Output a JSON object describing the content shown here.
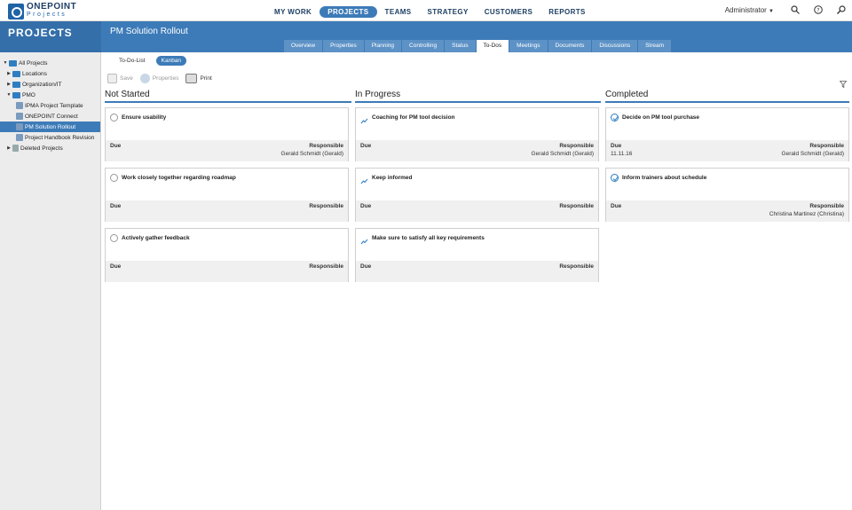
{
  "brand": {
    "line1": "ONEPOINT",
    "line2": "Projects"
  },
  "nav": [
    {
      "label": "MY WORK"
    },
    {
      "label": "PROJECTS"
    },
    {
      "label": "TEAMS"
    },
    {
      "label": "STRATEGY"
    },
    {
      "label": "CUSTOMERS"
    },
    {
      "label": "REPORTS"
    }
  ],
  "user": {
    "label": "Administrator"
  },
  "header": {
    "section": "PROJECTS",
    "project": "PM Solution Rollout"
  },
  "tabs": [
    {
      "label": "Overview"
    },
    {
      "label": "Properties"
    },
    {
      "label": "Planning"
    },
    {
      "label": "Controlling"
    },
    {
      "label": "Status"
    },
    {
      "label": "To-Dos"
    },
    {
      "label": "Meetings"
    },
    {
      "label": "Documents"
    },
    {
      "label": "Discussions"
    },
    {
      "label": "Stream"
    }
  ],
  "tree": [
    {
      "label": "All Projects"
    },
    {
      "label": "Locations"
    },
    {
      "label": "Organization/IT"
    },
    {
      "label": "PMO"
    },
    {
      "label": "IPMA Project Template"
    },
    {
      "label": "ONEPOINT Connect"
    },
    {
      "label": "PM Solution Rollout"
    },
    {
      "label": "Project Handbook Revision"
    },
    {
      "label": "Deleted Projects"
    }
  ],
  "subnav": {
    "list": "To-Do-List",
    "kanban": "Kanban"
  },
  "toolbar": {
    "save": "Save",
    "properties": "Properties",
    "print": "Print"
  },
  "columns": [
    {
      "title": "Not Started",
      "cards": [
        {
          "title": "Ensure usability",
          "due_label": "Due",
          "due": "",
          "resp_label": "Responsible",
          "resp": "Gerald Schmidt (Gerald)"
        },
        {
          "title": "Work closely together regarding roadmap",
          "due_label": "Due",
          "due": "",
          "resp_label": "Responsible",
          "resp": ""
        },
        {
          "title": "Actively gather feedback",
          "due_label": "Due",
          "due": "",
          "resp_label": "Responsible",
          "resp": ""
        }
      ]
    },
    {
      "title": "In Progress",
      "cards": [
        {
          "title": "Coaching for PM tool decision",
          "due_label": "Due",
          "due": "",
          "resp_label": "Responsible",
          "resp": "Gerald Schmidt (Gerald)"
        },
        {
          "title": "Keep informed",
          "due_label": "Due",
          "due": "",
          "resp_label": "Responsible",
          "resp": ""
        },
        {
          "title": "Make sure to satisfy all key requirements",
          "due_label": "Due",
          "due": "",
          "resp_label": "Responsible",
          "resp": ""
        }
      ]
    },
    {
      "title": "Completed",
      "cards": [
        {
          "title": "Decide on PM tool purchase",
          "due_label": "Due",
          "due": "11.11.16",
          "resp_label": "Responsible",
          "resp": "Gerald Schmidt (Gerald)"
        },
        {
          "title": "Inform trainers about schedule",
          "due_label": "Due",
          "due": "",
          "resp_label": "Responsible",
          "resp": "Christina Martinez (Christina)"
        }
      ]
    }
  ],
  "colors": {
    "accent": "#3d7bb8",
    "band": "#3d7bb8",
    "sidebar": "#ececec"
  }
}
